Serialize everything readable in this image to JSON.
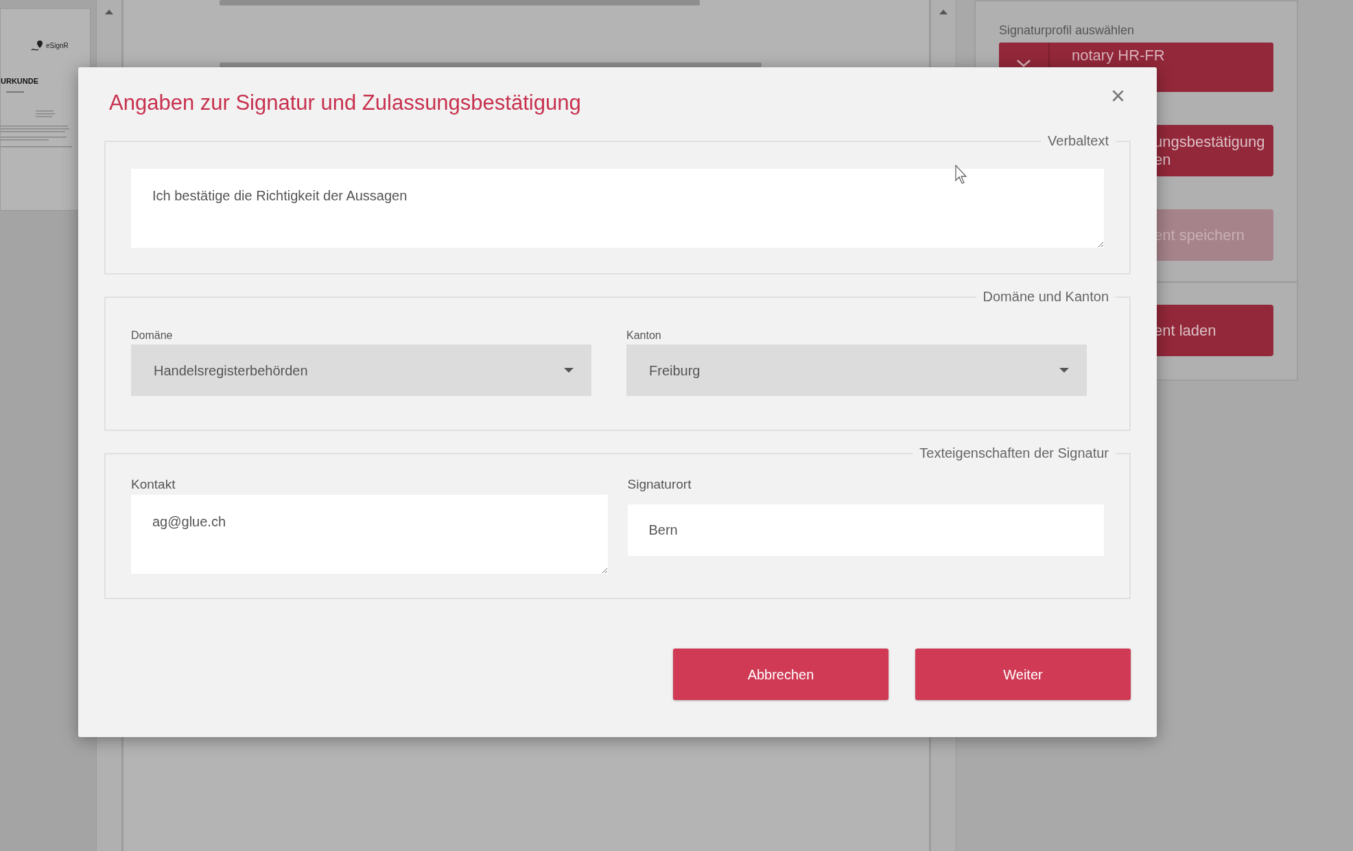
{
  "thumbnail": {
    "logo": "eSignR",
    "heading": "URKUNDE"
  },
  "side_panel": {
    "label": "Signaturprofil auswählen",
    "profile": "notary HR-FR",
    "buttons": [
      {
        "lines": [
          "ungsbestätigung",
          "en"
        ],
        "disabled": false
      },
      {
        "lines": [
          "ent speichern"
        ],
        "disabled": true
      },
      {
        "lines": [
          "ent laden"
        ],
        "disabled": false
      }
    ]
  },
  "dialog": {
    "title": "Angaben zur Signatur und Zulassungsbestätigung",
    "close": "×",
    "sections": [
      {
        "legend": "Verbaltext",
        "fields": [
          {
            "kind": "textarea",
            "value": "Ich bestätige die Richtigkeit der Aussagen"
          }
        ]
      },
      {
        "legend": "Domäne und Kanton",
        "fields": [
          {
            "kind": "select",
            "label": "Domäne",
            "value": "Handelsregisterbehörden"
          },
          {
            "kind": "select",
            "label": "Kanton",
            "value": "Freiburg"
          }
        ]
      },
      {
        "legend": "Texteigenschaften der Signatur",
        "fields": [
          {
            "kind": "textarea",
            "label": "Kontakt",
            "value": "ag@glue.ch"
          },
          {
            "kind": "input",
            "label": "Signaturort",
            "value": "Bern"
          }
        ]
      }
    ],
    "buttons": [
      "Abbrechen",
      "Weiter"
    ]
  }
}
